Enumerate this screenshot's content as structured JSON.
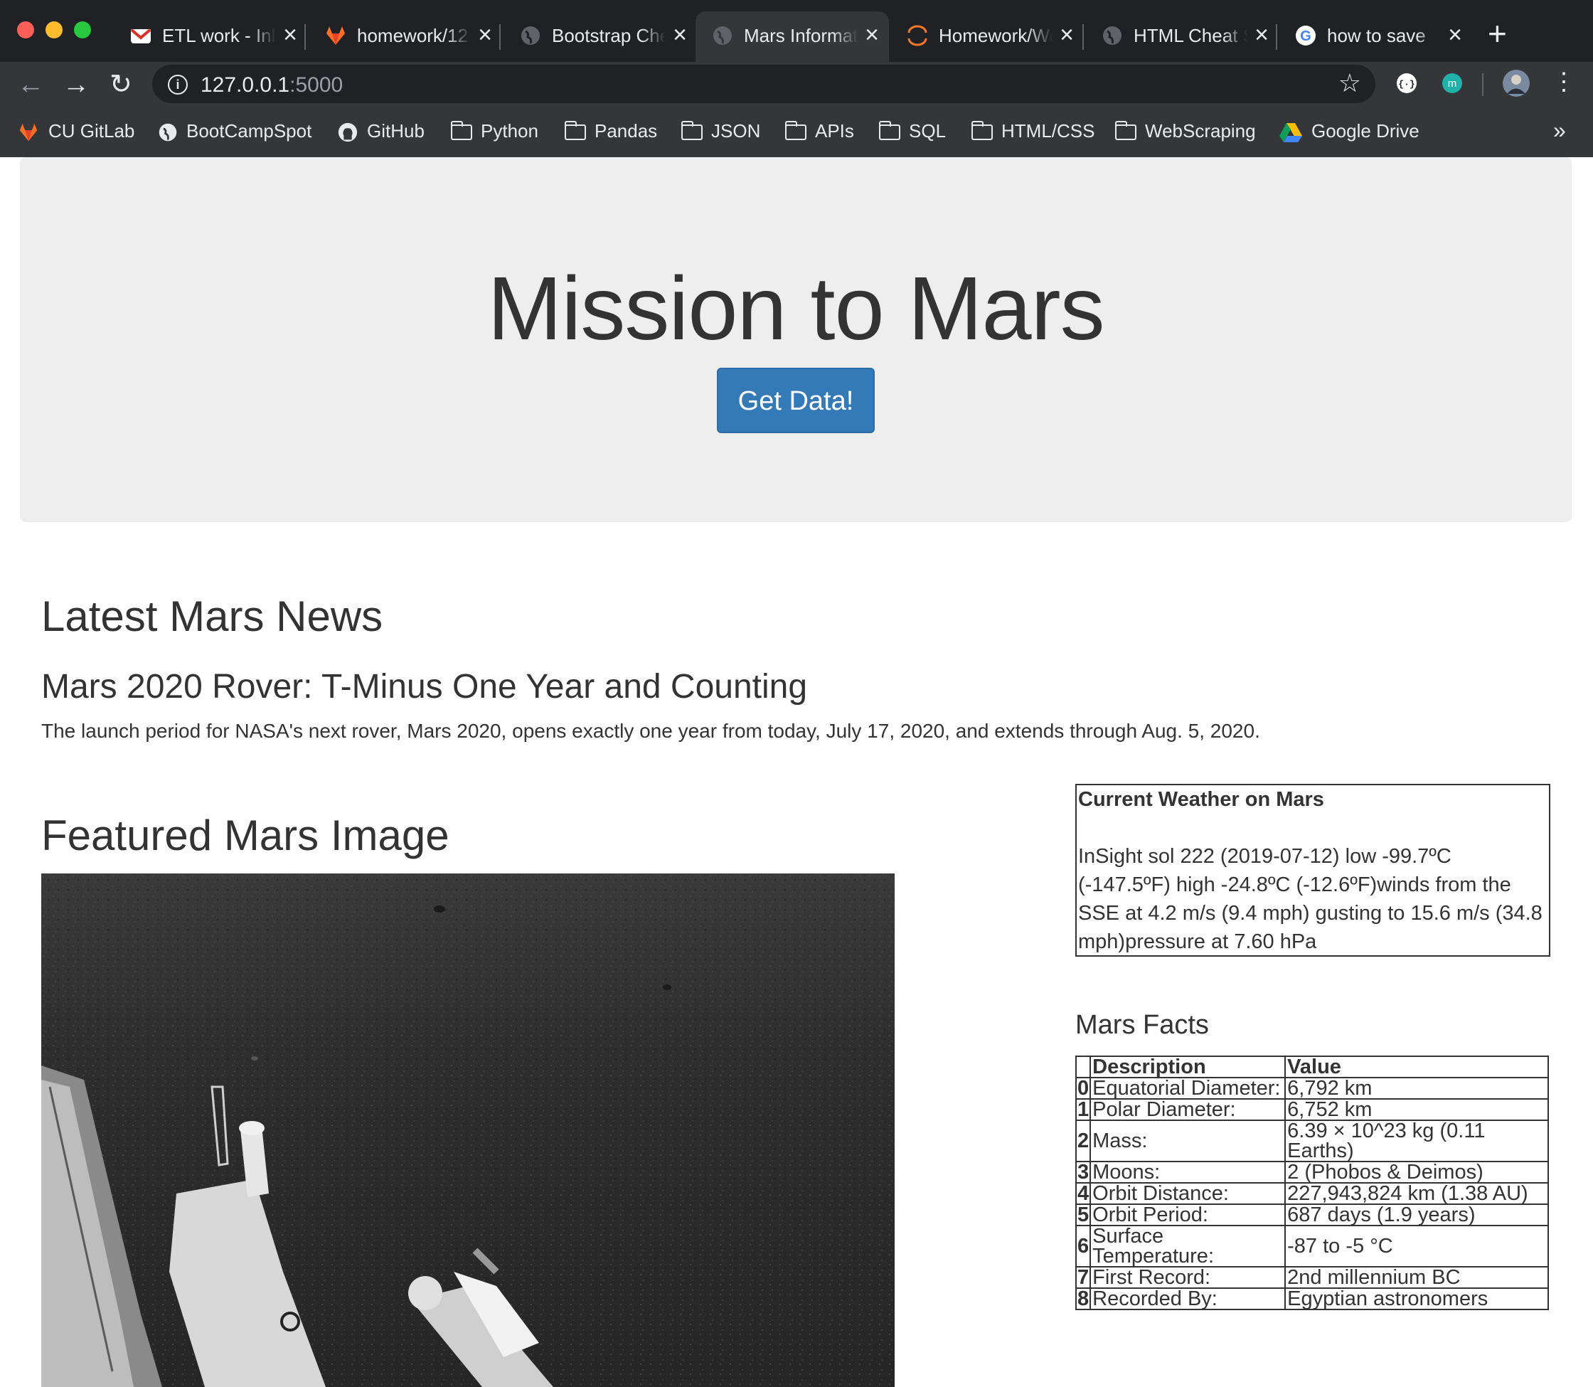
{
  "browser": {
    "tabs": [
      {
        "title": "ETL work - Inbox",
        "icon": "gmail-icon"
      },
      {
        "title": "homework/12",
        "icon": "gitlab-icon"
      },
      {
        "title": "Bootstrap Cheat",
        "icon": "globe-icon"
      },
      {
        "title": "Mars Information",
        "icon": "globe-icon",
        "active": true
      },
      {
        "title": "Homework/Web",
        "icon": "jupyter-icon"
      },
      {
        "title": "HTML Cheat Sheet",
        "icon": "globe-icon"
      },
      {
        "title": "how to save",
        "icon": "google-icon"
      }
    ],
    "url_host": "127.0.0.1",
    "url_port": ":5000",
    "bookmarks": [
      {
        "label": "CU GitLab",
        "icon": "gitlab-icon"
      },
      {
        "label": "BootCampSpot",
        "icon": "globe-icon"
      },
      {
        "label": "GitHub",
        "icon": "github-icon"
      },
      {
        "label": "Python",
        "icon": "folder-icon"
      },
      {
        "label": "Pandas",
        "icon": "folder-icon"
      },
      {
        "label": "JSON",
        "icon": "folder-icon"
      },
      {
        "label": "APIs",
        "icon": "folder-icon"
      },
      {
        "label": "SQL",
        "icon": "folder-icon"
      },
      {
        "label": "HTML/CSS",
        "icon": "folder-icon"
      },
      {
        "label": "WebScraping",
        "icon": "folder-icon"
      },
      {
        "label": "Google Drive",
        "icon": "google-drive-icon"
      }
    ],
    "bookmarks_more": "»"
  },
  "jumbotron": {
    "title": "Mission to Mars",
    "button_label": "Get Data!"
  },
  "news": {
    "heading": "Latest Mars News",
    "title": "Mars 2020 Rover: T-Minus One Year and Counting",
    "paragraph": "The launch period for NASA's next rover, Mars 2020, opens exactly one year from today, July 17, 2020, and extends through Aug. 5, 2020."
  },
  "featured": {
    "heading": "Featured Mars Image"
  },
  "weather": {
    "heading": "Current Weather on Mars",
    "text": "InSight sol 222 (2019-07-12) low -99.7ºC (-147.5ºF) high -24.8ºC (-12.6ºF)winds from the SSE at 4.2 m/s (9.4 mph) gusting to 15.6 m/s (34.8 mph)pressure at 7.60 hPa"
  },
  "facts": {
    "heading": "Mars Facts",
    "columns": [
      "",
      "Description",
      "Value"
    ],
    "rows": [
      {
        "index": "0",
        "description": "Equatorial Diameter:",
        "value": "6,792 km"
      },
      {
        "index": "1",
        "description": "Polar Diameter:",
        "value": "6,752 km"
      },
      {
        "index": "2",
        "description": "Mass:",
        "value": "6.39 × 10^23 kg (0.11 Earths)"
      },
      {
        "index": "3",
        "description": "Moons:",
        "value": "2 (Phobos & Deimos)"
      },
      {
        "index": "4",
        "description": "Orbit Distance:",
        "value": "227,943,824 km (1.38 AU)"
      },
      {
        "index": "5",
        "description": "Orbit Period:",
        "value": "687 days (1.9 years)"
      },
      {
        "index": "6",
        "description": "Surface Temperature:",
        "value": "-87 to -5 °C"
      },
      {
        "index": "7",
        "description": "First Record:",
        "value": "2nd millennium BC"
      },
      {
        "index": "8",
        "description": "Recorded By:",
        "value": "Egyptian astronomers"
      }
    ]
  },
  "colors": {
    "button_primary": "#337ab7",
    "jumbotron_bg": "#eeeeee",
    "chrome_dark": "#202124",
    "chrome_toolbar": "#35363a"
  }
}
